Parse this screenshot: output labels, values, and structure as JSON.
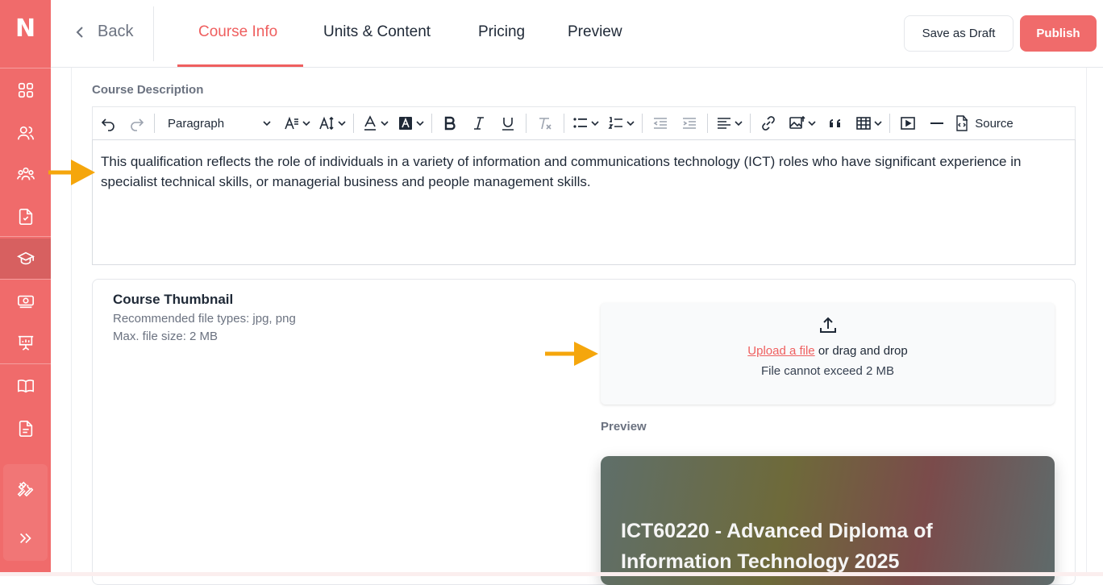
{
  "sidebar": {
    "logo": "N",
    "items": [
      {
        "icon": "dashboard-grid-icon"
      },
      {
        "icon": "users-icon"
      },
      {
        "icon": "groups-icon"
      },
      {
        "icon": "assignment-check-icon"
      },
      {
        "icon": "graduation-cap-icon",
        "active": true
      },
      {
        "icon": "payments-icon"
      },
      {
        "icon": "presentation-icon"
      },
      {
        "icon": "book-icon"
      },
      {
        "icon": "document-icon"
      },
      {
        "icon": "tools-icon"
      },
      {
        "icon": "expand-icon"
      }
    ]
  },
  "topbar": {
    "back_label": "Back",
    "tabs": [
      {
        "label": "Course Info",
        "active": true
      },
      {
        "label": "Units & Content"
      },
      {
        "label": "Pricing"
      },
      {
        "label": "Preview"
      }
    ],
    "save_draft_label": "Save as Draft",
    "publish_label": "Publish"
  },
  "description": {
    "label": "Course Description",
    "paragraph_select": "Paragraph",
    "source_label": "Source",
    "text": "This qualification reflects the role of individuals in a variety of information and communications technology (ICT) roles who have significant experience in specialist technical skills, or managerial business and people management skills."
  },
  "thumbnail": {
    "title": "Course Thumbnail",
    "types_note": "Recommended file types: jpg, png",
    "size_note": "Max. file size: 2 MB",
    "upload_link": "Upload a file",
    "upload_rest": " or drag and drop",
    "limit_note": "File cannot exceed 2 MB",
    "preview_label": "Preview",
    "preview_title": "ICT60220 - Advanced Diploma of Information Technology 2025"
  },
  "colors": {
    "brand": "#f06b6b",
    "accent_text": "#ef5f5f",
    "annotation_arrow": "#f5a60c"
  }
}
